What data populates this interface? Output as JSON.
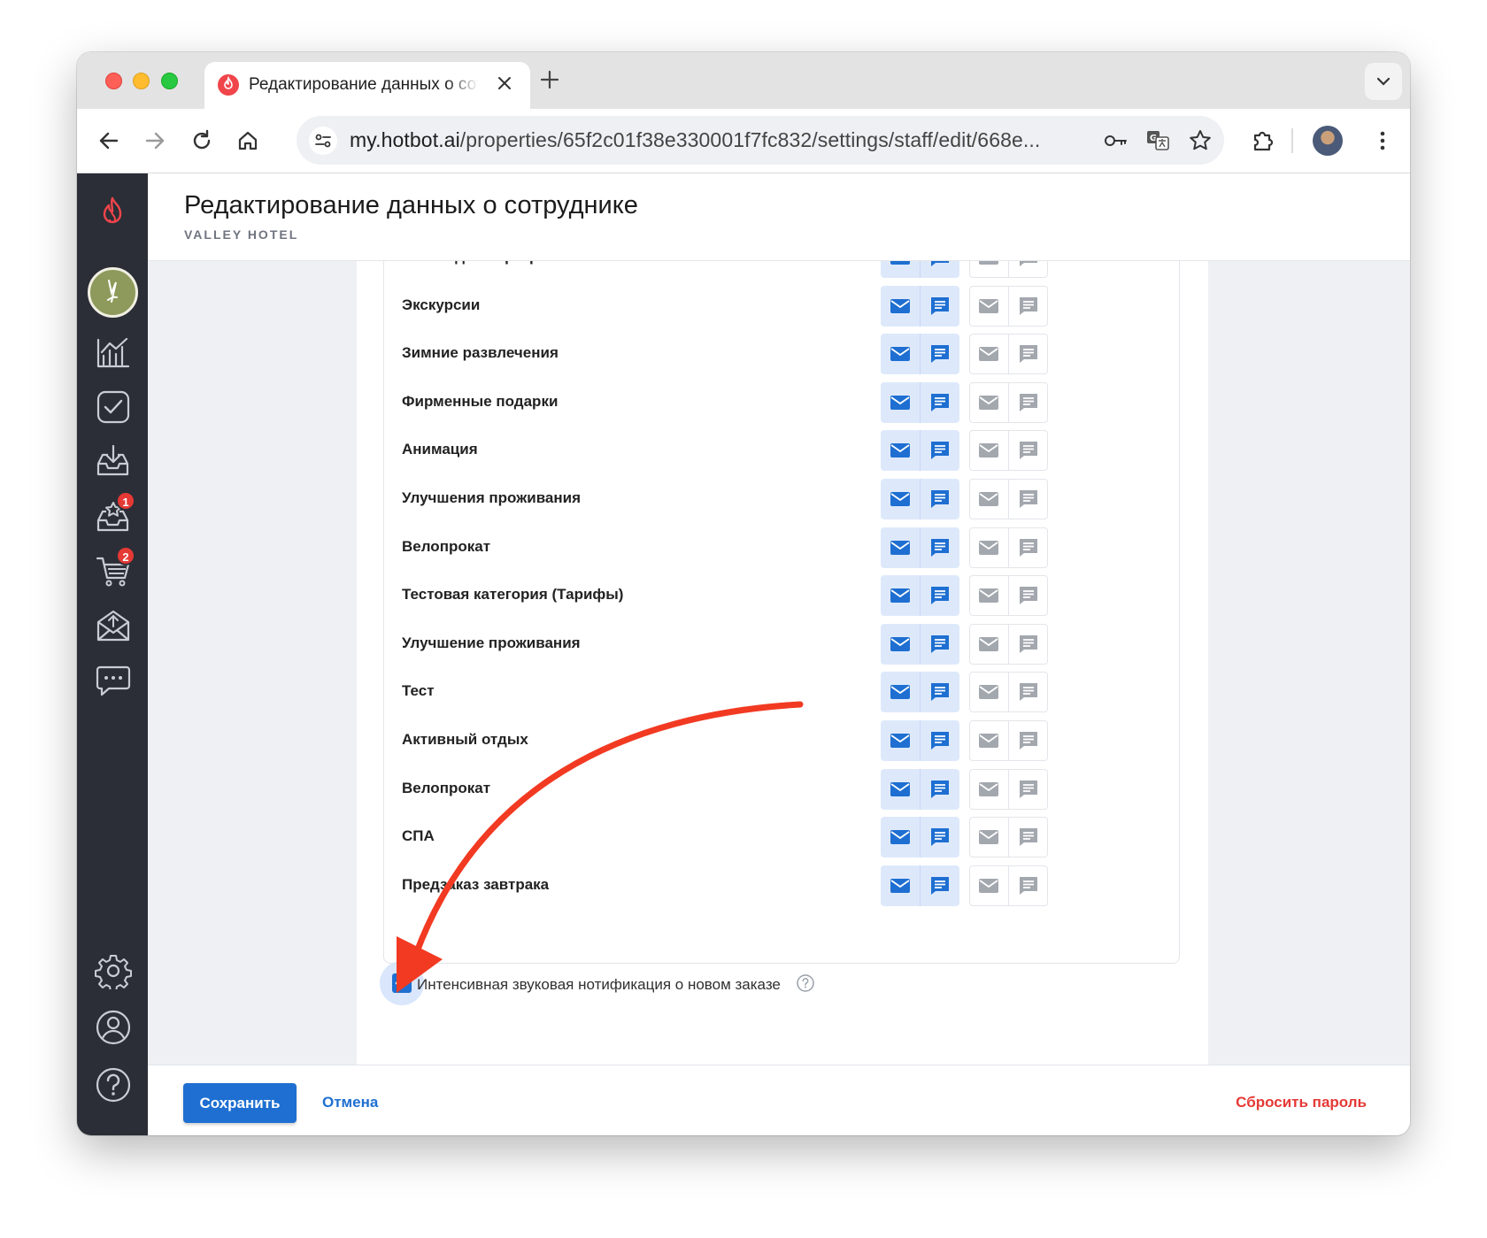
{
  "browser": {
    "tab_title": "Редактирование данных о сотруднике",
    "url_host": "my.hotbot.ai",
    "url_path": "/properties/65f2c01f38e330001f7fc832/settings/staff/edit/668e..."
  },
  "sidebar": {
    "badges": {
      "reviews": "1",
      "orders": "2"
    }
  },
  "page": {
    "title": "Редактирование данных о сотруднике",
    "subtitle": "VALLEY HOTEL"
  },
  "categories": [
    "Новогодняя программа",
    "Экскурсии",
    "Зимние развлечения",
    "Фирменные подарки",
    "Анимация",
    "Улучшения проживания",
    "Велопрокат",
    "Тестовая категория (Тарифы)",
    "Улучшение проживания",
    "Тест",
    "Активный отдых",
    "Велопрокат",
    "СПА",
    "Предзаказ завтрака"
  ],
  "intensive_sound": {
    "label": "Интенсивная звуковая нотификация о новом заказе",
    "checked": true
  },
  "footer": {
    "save": "Сохранить",
    "cancel": "Отмена",
    "reset_password": "Сбросить пароль"
  },
  "colors": {
    "accent": "#1e6fd1",
    "danger": "#e53935",
    "sidebar": "#2b2e36",
    "annotation_arrow": "#f23a22"
  }
}
